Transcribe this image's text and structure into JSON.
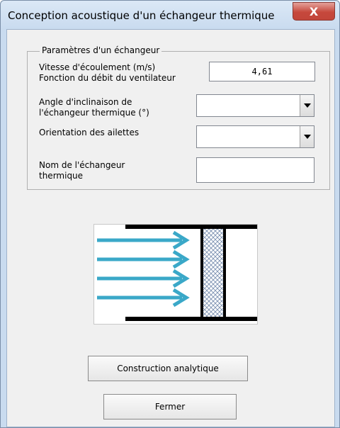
{
  "window": {
    "title": "Conception acoustique d'un échangeur thermique",
    "close_glyph": "X"
  },
  "group": {
    "legend": "Paramètres d'un échangeur",
    "fields": {
      "speed": {
        "label_line1": "Vitesse d'écoulement (m/s)",
        "label_line2": "Fonction du débit du ventilateur",
        "value": "4,61"
      },
      "angle": {
        "label_line1": "Angle d'inclinaison de",
        "label_line2": "l'échangeur thermique (°)",
        "value": ""
      },
      "orientation": {
        "label": "Orientation des ailettes",
        "value": ""
      },
      "name": {
        "label_line1": "Nom de l'échangeur",
        "label_line2": "thermique",
        "value": ""
      }
    }
  },
  "diagram": {
    "arrow_color": "#3aa8c8",
    "wall_color": "#000000",
    "mesh_color": "#7a8fb0",
    "arrow_count": 4
  },
  "buttons": {
    "construction": "Construction analytique",
    "close": "Fermer"
  }
}
